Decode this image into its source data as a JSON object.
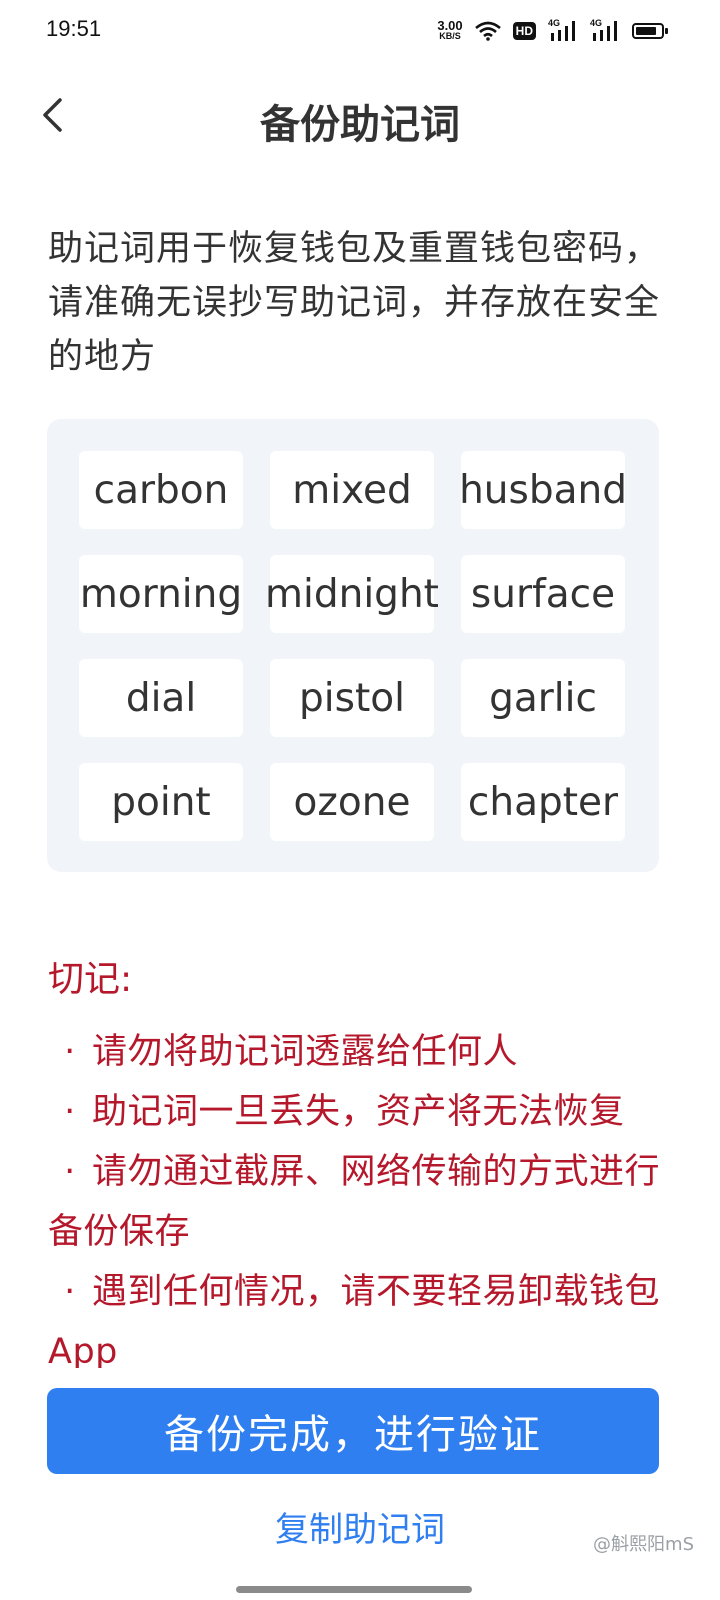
{
  "status_bar": {
    "time": "19:51",
    "net_speed_value": "3.00",
    "net_speed_unit": "KB/S",
    "hd_label": "HD",
    "signal_1_label": "4G",
    "signal_2_label": "4G",
    "battery_level_percent": 85,
    "icons": [
      "wifi-icon",
      "hd-icon",
      "signal-icon",
      "signal-icon",
      "battery-icon"
    ]
  },
  "header": {
    "title": "备份助记词",
    "back_icon": "chevron-left-icon"
  },
  "intro_text": "助记词用于恢复钱包及重置钱包密码，请准确无误抄写助记词，并存放在安全的地方",
  "mnemonic_words": [
    "carbon",
    "mixed",
    "husband",
    "morning",
    "midnight",
    "surface",
    "dial",
    "pistol",
    "garlic",
    "point",
    "ozone",
    "chapter"
  ],
  "warning": {
    "title": "切记:",
    "bullet": "·",
    "items": [
      "请勿将助记词透露给任何人",
      "助记词一旦丢失，资产将无法恢复",
      "请勿通过截屏、网络传输的方式进行备份保存",
      "遇到任何情况，请不要轻易卸载钱包App"
    ]
  },
  "primary_button_label": "备份完成，进行验证",
  "copy_link_label": "复制助记词",
  "watermark": "@斛熙阳mS",
  "colors": {
    "accent": "#2f7ff0",
    "warning": "#b5172b",
    "panel_bg": "#f1f4f8",
    "text": "#333333"
  }
}
